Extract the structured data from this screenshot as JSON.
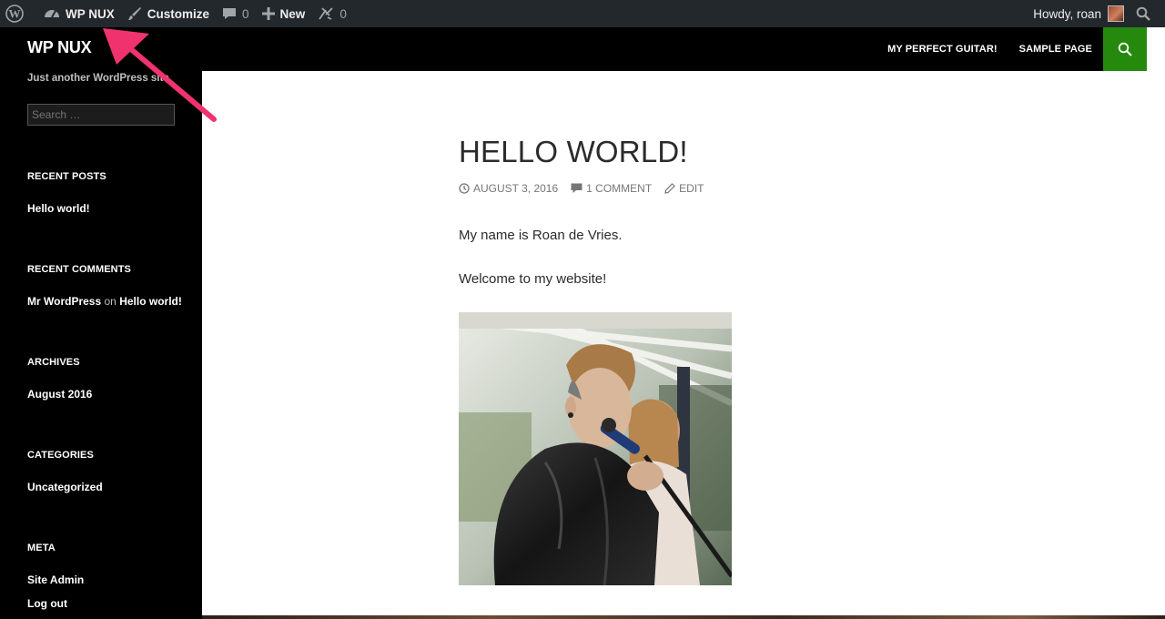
{
  "adminbar": {
    "site_name": "WP NUX",
    "customize": "Customize",
    "comments_count": "0",
    "new_label": "New",
    "updates_count": "0",
    "howdy": "Howdy, roan",
    "icons": [
      "wordpress-logo-icon",
      "dashboard-icon",
      "paintbrush-icon",
      "comment-icon",
      "plus-icon",
      "updates-icon",
      "search-icon"
    ]
  },
  "header": {
    "site_title": "WP NUX",
    "tagline": "Just another WordPress site",
    "nav": [
      "MY PERFECT GUITAR!",
      "SAMPLE PAGE"
    ],
    "accent_color": "#24890d"
  },
  "sidebar": {
    "search_placeholder": "Search …",
    "widgets": {
      "recent_posts": {
        "title": "RECENT POSTS",
        "items": [
          "Hello world!"
        ]
      },
      "recent_comments": {
        "title": "RECENT COMMENTS",
        "author": "Mr WordPress",
        "on": "on",
        "post": "Hello world!"
      },
      "archives": {
        "title": "ARCHIVES",
        "items": [
          "August 2016"
        ]
      },
      "categories": {
        "title": "CATEGORIES",
        "items": [
          "Uncategorized"
        ]
      },
      "meta": {
        "title": "META",
        "items": [
          "Site Admin",
          "Log out"
        ]
      }
    }
  },
  "post": {
    "title": "HELLO WORLD!",
    "date": "AUGUST 3, 2016",
    "comments": "1 COMMENT",
    "edit": "EDIT",
    "paragraphs": [
      "My name is Roan de Vries.",
      "Welcome to my website!"
    ]
  },
  "annotation": {
    "arrow_color": "#f0336e"
  }
}
